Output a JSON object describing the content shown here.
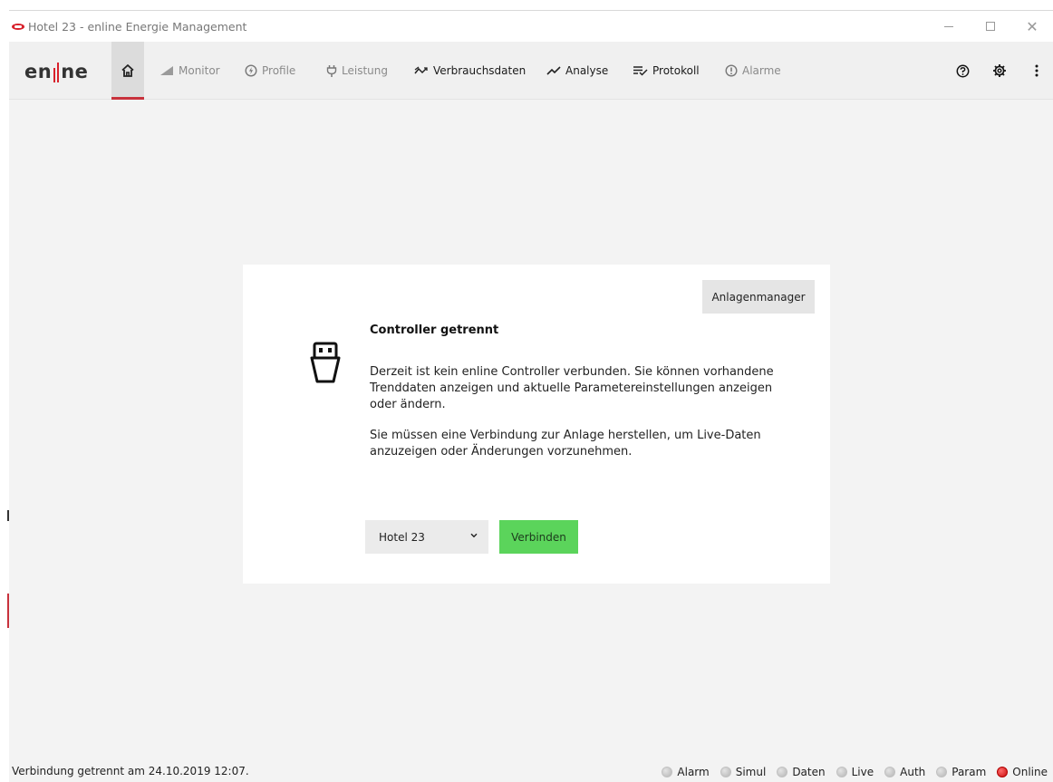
{
  "window": {
    "title": "Hotel 23 - enline Energie Management",
    "controls": [
      "minimize",
      "maximize",
      "close"
    ]
  },
  "navbar": {
    "logo": {
      "left": "en",
      "right": "ne"
    },
    "home_icon": "home-icon",
    "items": [
      {
        "label": "Monitor",
        "icon": "signal-icon",
        "enabled": false
      },
      {
        "label": "Profile",
        "icon": "bolt-circle-icon",
        "enabled": false
      },
      {
        "label": "Leistung",
        "icon": "plug-icon",
        "enabled": false
      },
      {
        "label": "Verbrauchsdaten",
        "icon": "trend-icon",
        "enabled": true
      },
      {
        "label": "Analyse",
        "icon": "line-chart-icon",
        "enabled": true
      },
      {
        "label": "Protokoll",
        "icon": "list-check-icon",
        "enabled": true
      },
      {
        "label": "Alarme",
        "icon": "alert-circle-icon",
        "enabled": false
      }
    ],
    "right_icons": [
      "help-icon",
      "settings-icon",
      "more-icon"
    ]
  },
  "main": {
    "manager_button": "Anlagenmanager",
    "title": "Controller getrennt",
    "text1": "Derzeit ist kein enline Controller verbunden. Sie können vorhandene Trenddaten anzeigen und aktuelle Parametereinstellungen anzeigen oder ändern.",
    "text2": "Sie müssen eine Verbindung zur Anlage herstellen, um Live-Daten anzuzeigen oder Änderungen vorzunehmen.",
    "select_value": "Hotel 23",
    "connect_button": "Verbinden"
  },
  "statusbar": {
    "message": "Verbindung getrennt am 24.10.2019 12:07.",
    "indicators": [
      {
        "label": "Alarm",
        "state": "off"
      },
      {
        "label": "Simul",
        "state": "off"
      },
      {
        "label": "Daten",
        "state": "off"
      },
      {
        "label": "Live",
        "state": "off"
      },
      {
        "label": "Auth",
        "state": "off"
      },
      {
        "label": "Param",
        "state": "off"
      },
      {
        "label": "Online",
        "state": "red"
      }
    ]
  },
  "colors": {
    "accent_red": "#d8202b",
    "connect_green": "#5bd45b",
    "background": "#f3f3f3",
    "card": "#ffffff"
  }
}
